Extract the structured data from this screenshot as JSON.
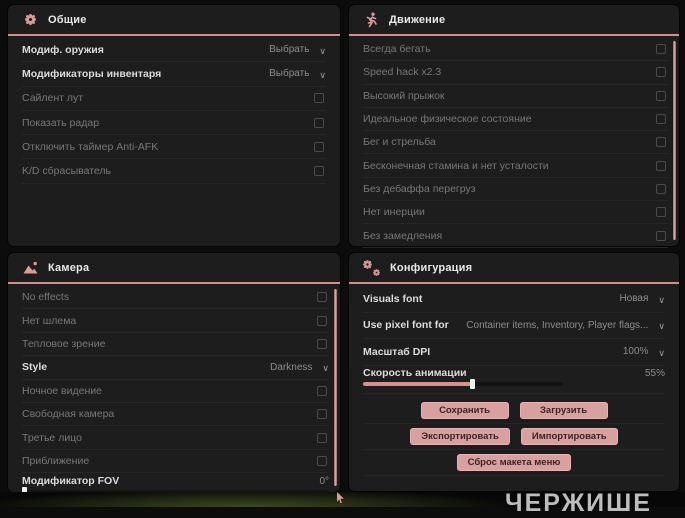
{
  "colors": {
    "accent": "#d89c9c",
    "panel_bg": "#1d1d1d",
    "page_bg": "#0c0c0c"
  },
  "watermark": "ЧЕРЖИШЕ",
  "panels": {
    "general": {
      "title": "Общие",
      "icon": "gear-icon",
      "rows": [
        {
          "label": "Модиф. оружия",
          "control": "dropdown",
          "value": "Выбрать",
          "strong": true
        },
        {
          "label": "Модификаторы инвентаря",
          "control": "dropdown",
          "value": "Выбрать",
          "strong": true
        },
        {
          "label": "Сайлент лут",
          "control": "checkbox",
          "checked": false
        },
        {
          "label": "Показать радар",
          "control": "checkbox",
          "checked": false
        },
        {
          "label": "Отключить таймер Anti-AFK",
          "control": "checkbox",
          "checked": false
        },
        {
          "label": "K/D сбрасыватель",
          "control": "checkbox",
          "checked": false
        }
      ]
    },
    "movement": {
      "title": "Движение",
      "icon": "runner-icon",
      "rows": [
        {
          "label": "Всегда бегать",
          "control": "checkbox",
          "checked": false
        },
        {
          "label": "Speed hack x2.3",
          "control": "checkbox",
          "checked": false
        },
        {
          "label": "Высокий прыжок",
          "control": "checkbox",
          "checked": false
        },
        {
          "label": "Идеальное физическое состояние",
          "control": "checkbox",
          "checked": false
        },
        {
          "label": "Бег и стрельба",
          "control": "checkbox",
          "checked": false
        },
        {
          "label": "Бесконечная стамина и нет усталости",
          "control": "checkbox",
          "checked": false
        },
        {
          "label": "Без дебаффа перегруз",
          "control": "checkbox",
          "checked": false
        },
        {
          "label": "Нет инерции",
          "control": "checkbox",
          "checked": false
        },
        {
          "label": "Без замедления",
          "control": "checkbox",
          "checked": false
        }
      ]
    },
    "camera": {
      "title": "Камера",
      "icon": "image-icon",
      "rows": [
        {
          "label": "No effects",
          "control": "checkbox",
          "checked": false
        },
        {
          "label": "Нет шлема",
          "control": "checkbox",
          "checked": false
        },
        {
          "label": "Тепловое зрение",
          "control": "checkbox",
          "checked": false
        },
        {
          "label": "Style",
          "control": "dropdown",
          "value": "Darkness",
          "strong": true
        },
        {
          "label": "Ночное видение",
          "control": "checkbox",
          "checked": false
        },
        {
          "label": "Свободная камера",
          "control": "checkbox",
          "checked": false
        },
        {
          "label": "Третье лицо",
          "control": "checkbox",
          "checked": false
        },
        {
          "label": "Приближение",
          "control": "checkbox",
          "checked": false
        },
        {
          "label": "Модификатор FOV",
          "control": "slider",
          "value": "0°",
          "percent": 0,
          "strong": true
        }
      ]
    },
    "config": {
      "title": "Конфигурация",
      "icon": "gears-icon",
      "rows": [
        {
          "label": "Visuals font",
          "control": "dropdown",
          "value": "Новая",
          "strong": true
        },
        {
          "label": "Use pixel font for",
          "control": "dropdown",
          "value": "Container items, Inventory, Player flags...",
          "strong": true
        },
        {
          "label": "Масштаб DPI",
          "control": "dropdown",
          "value": "100%",
          "strong": true
        },
        {
          "label": "Скорость анимации",
          "control": "slider",
          "value": "55%",
          "percent": 55,
          "strong": true
        }
      ],
      "buttons": [
        {
          "label": "Сохранить"
        },
        {
          "label": "Загрузить"
        },
        {
          "label": "Экспортировать"
        },
        {
          "label": "Импортировать"
        },
        {
          "label": "Сброс макета меню"
        }
      ]
    }
  }
}
